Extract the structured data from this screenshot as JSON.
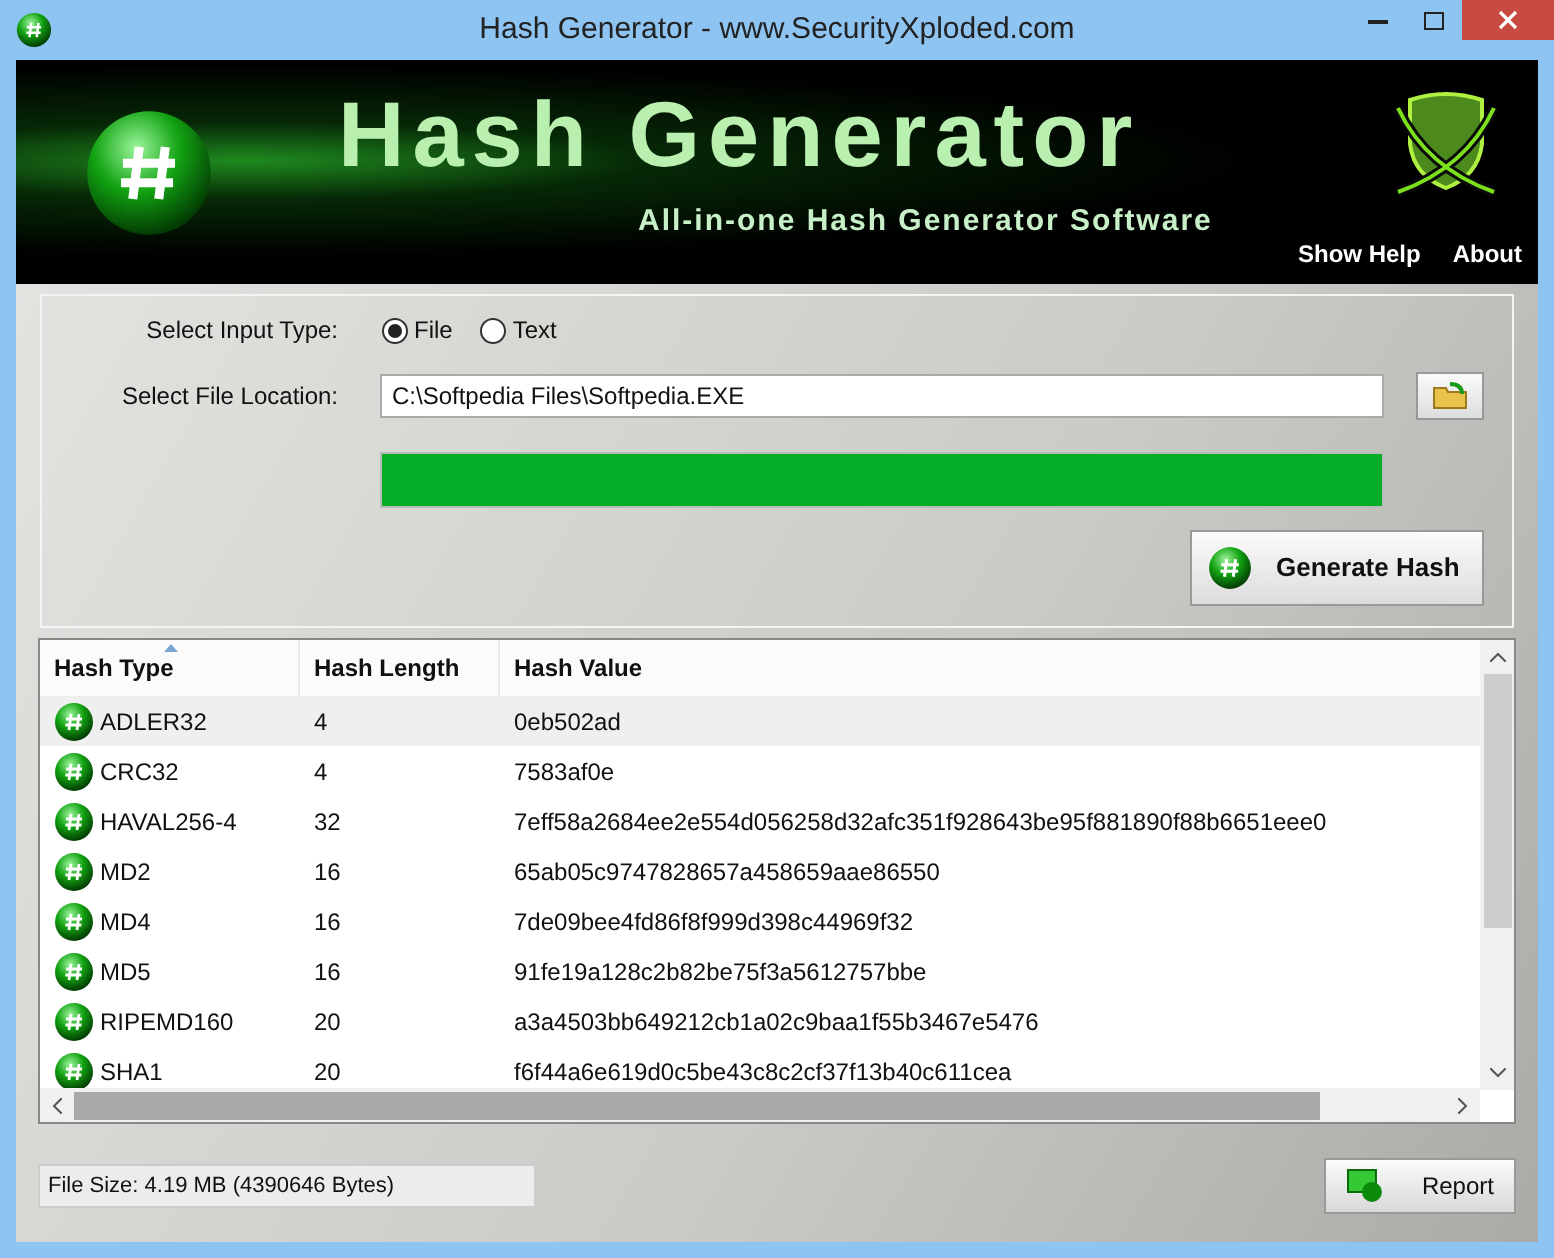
{
  "window": {
    "title": "Hash Generator - www.SecurityXploded.com"
  },
  "banner": {
    "title": "Hash Generator",
    "subtitle": "All-in-one Hash Generator Software",
    "links": [
      "Show Help",
      "About"
    ]
  },
  "form": {
    "input_type_label": "Select Input Type:",
    "input_types": [
      {
        "label": "File",
        "selected": true
      },
      {
        "label": "Text",
        "selected": false
      }
    ],
    "file_label": "Select File Location:",
    "file_path": "C:\\Softpedia Files\\Softpedia.EXE",
    "progress": {
      "level": 1
    },
    "generate_button": "Generate Hash"
  },
  "table": {
    "columns": [
      "Hash Type",
      "Hash Length",
      "Hash Value"
    ],
    "rows": [
      {
        "type": "ADLER32",
        "length": "4",
        "value": "0eb502ad",
        "selected": true
      },
      {
        "type": "CRC32",
        "length": "4",
        "value": "7583af0e",
        "selected": false
      },
      {
        "type": "HAVAL256-4",
        "length": "32",
        "value": "7eff58a2684ee2e554d056258d32afc351f928643be95f881890f88b6651eee0",
        "selected": false
      },
      {
        "type": "MD2",
        "length": "16",
        "value": "65ab05c9747828657a458659aae86550",
        "selected": false
      },
      {
        "type": "MD4",
        "length": "16",
        "value": "7de09bee4fd86f8f999d398c44969f32",
        "selected": false
      },
      {
        "type": "MD5",
        "length": "16",
        "value": "91fe19a128c2b82be75f3a5612757bbe",
        "selected": false
      },
      {
        "type": "RIPEMD160",
        "length": "20",
        "value": "a3a4503bb649212cb1a02c9baa1f55b3467e5476",
        "selected": false
      },
      {
        "type": "SHA1",
        "length": "20",
        "value": "f6f44a6e619d0c5be43c8c2cf37f13b40c611cea",
        "selected": false
      }
    ]
  },
  "status_bar": {
    "file_size": "File Size: 4.19 MB (4390646 Bytes)",
    "report_button": "Report"
  }
}
